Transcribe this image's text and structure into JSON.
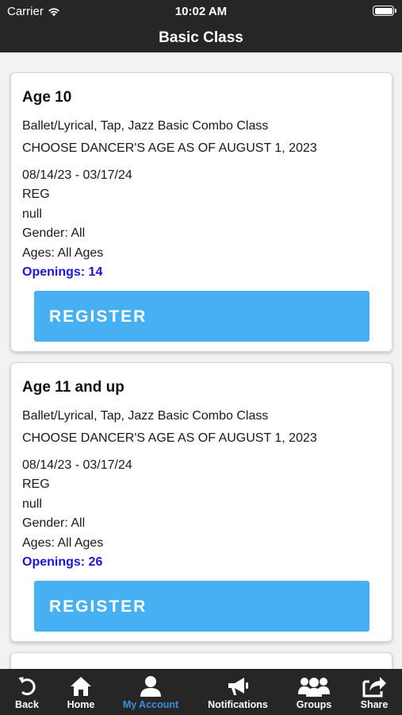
{
  "status_bar": {
    "carrier": "Carrier",
    "time": "10:02 AM"
  },
  "header": {
    "title": "Basic Class"
  },
  "classes": [
    {
      "title": "Age 10",
      "description": "Ballet/Lyrical, Tap, Jazz Basic Combo Class",
      "note": "CHOOSE DANCER'S AGE AS OF AUGUST 1, 2023",
      "dates": "08/14/23 - 03/17/24",
      "type": "REG",
      "extra": "null",
      "gender": "Gender: All",
      "ages": "Ages: All Ages",
      "openings": "Openings: 14",
      "register_label": "REGISTER"
    },
    {
      "title": "Age 11 and up",
      "description": "Ballet/Lyrical, Tap, Jazz Basic Combo Class",
      "note": "CHOOSE DANCER'S AGE AS OF AUGUST 1, 2023",
      "dates": "08/14/23 - 03/17/24",
      "type": "REG",
      "extra": "null",
      "gender": "Gender: All",
      "ages": "Ages: All Ages",
      "openings": "Openings: 26",
      "register_label": "REGISTER"
    }
  ],
  "tab_bar": {
    "back": "Back",
    "home": "Home",
    "my_account": "My Account",
    "notifications": "Notifications",
    "groups": "Groups",
    "share": "Share"
  },
  "colors": {
    "bar_background": "#262626",
    "register_button": "#46b0f2",
    "openings_text": "#1a16d6",
    "active_tab": "#3b8fe0"
  },
  "icons": [
    "wifi-icon",
    "battery-icon",
    "back-icon",
    "home-icon",
    "account-icon",
    "megaphone-icon",
    "groups-icon",
    "share-icon"
  ]
}
